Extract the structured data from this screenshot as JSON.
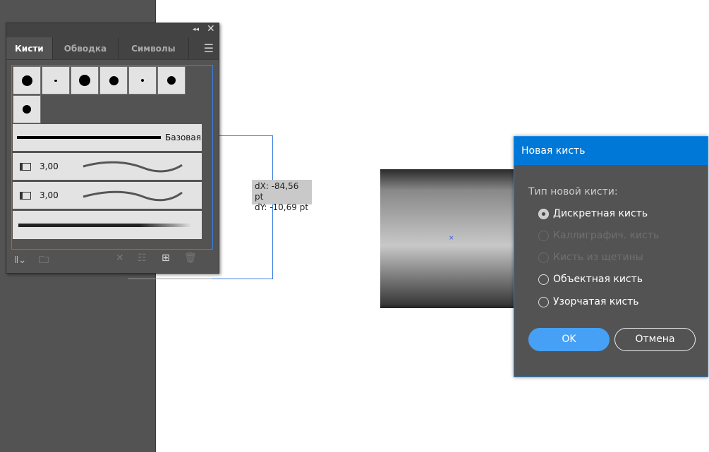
{
  "panel": {
    "tabs": [
      "Кисти",
      "Обводка",
      "Символы"
    ],
    "basic_brush_label": "Базовая",
    "brush_rows": [
      {
        "size": "3,00"
      },
      {
        "size": "3,00"
      }
    ]
  },
  "tooltip": {
    "dx": "dX: -84,56 pt",
    "dy": "dY: -10,69 pt"
  },
  "dialog": {
    "title": "Новая кисть",
    "group_label": "Тип новой кисти:",
    "options": [
      {
        "label": "Дискретная кисть",
        "selected": true,
        "enabled": true
      },
      {
        "label": "Каллиграфич. кисть",
        "selected": false,
        "enabled": false
      },
      {
        "label": "Кисть из щетины",
        "selected": false,
        "enabled": false
      },
      {
        "label": "Объектная кисть",
        "selected": false,
        "enabled": true
      },
      {
        "label": "Узорчатая кисть",
        "selected": false,
        "enabled": true
      }
    ],
    "ok_label": "OK",
    "cancel_label": "Отмена"
  },
  "colors": {
    "accent": "#0078d7",
    "ok_button": "#46a0f5"
  }
}
